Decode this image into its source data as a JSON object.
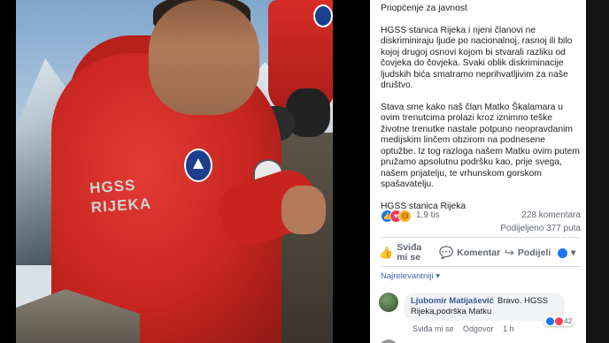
{
  "post": {
    "paragraphs": [
      "Priopćenje za javnost",
      "HGSS stanica Rijeka i njeni članovi ne diskriminiraju ljude po nacionalnoj, rasnoj ili bilo kojoj drugoj osnovi kojom bi stvarali razliku od čovjeka do čovjeka. Svaki oblik diskriminacije ljudskih bića smatramo neprihvatljivim za naše društvo.",
      "Stava sme kako naš član Matko Škalamara u ovim trenutcima prolazi kroz iznimno teške životne trenutke nastale potpuno neopravdanim medijskim linčem obzirom na podnesene optužbe. Iz tog razloga našem Matku ovim putem pružamo apsolutnu podršku kao, prije svega, našem prijatelju, te vrhunskom gorskom spašavatelju.",
      "HGSS stanica Rijeka"
    ]
  },
  "photo": {
    "jacket_text_line1": "HGSS",
    "jacket_text_line2": "RIJEKA"
  },
  "stats": {
    "reactions_count": "1,9 tis",
    "comments": "228 komentara",
    "shares": "Podijeljeno 377 puta",
    "reaction_icons": [
      "like-icon",
      "love-icon",
      "sad-icon"
    ]
  },
  "actions": {
    "like": "Sviđa mi se",
    "comment": "Komentar",
    "share": "Podijeli"
  },
  "sort": {
    "label": "Najrelevantniji ▾"
  },
  "comment": {
    "author": "Ljubomir Matijašević",
    "text": "Bravo. HGSS Rijeka,podrška Matku",
    "reaction_count": "42",
    "like_label": "Sviđa mi se",
    "reply_label": "Odgovor",
    "time": "1 h"
  },
  "colors": {
    "link": "#385898",
    "fb_blue": "#1877f2",
    "jacket_red": "#c72520"
  }
}
